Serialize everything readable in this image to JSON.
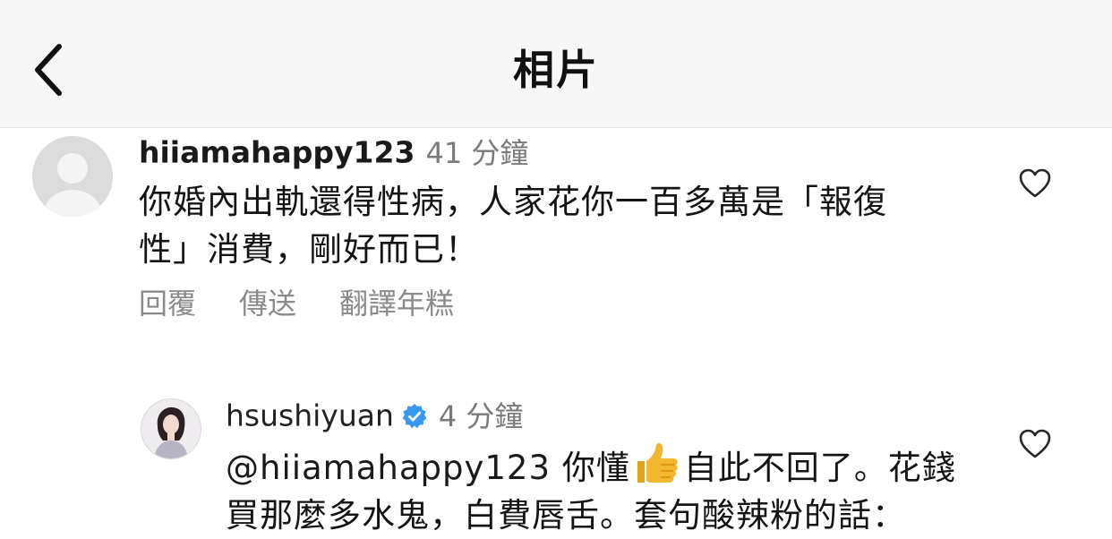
{
  "header": {
    "title": "相片"
  },
  "comments": [
    {
      "username": "hiiamahappy123",
      "time": "41 分鐘",
      "text_line1": "你婚內出軌還得性病，人家花你一百多萬是「報復",
      "text_line2": "性」消費，剛好而已！",
      "actions": [
        "回覆",
        "傳送",
        "翻譯年糕"
      ],
      "verified": false
    },
    {
      "username": "hsushiyuan",
      "time": "4 分鐘",
      "mention": "@hiiamahappy123",
      "text_line1_part1": " 你懂",
      "text_line1_part2": "自此不回了。花錢",
      "text_line2": "買那麼多水鬼，白費唇舌。套句酸辣粉的話：",
      "verified": true
    }
  ],
  "icons": {
    "back": "chevron-left-icon",
    "like": "heart-outline-icon",
    "verified": "verified-badge-icon",
    "thumbs_up": "thumbs-up-emoji",
    "avatar_default": "default-user-avatar"
  },
  "colors": {
    "header_bg": "#f7f7f7",
    "verified_blue": "#3897f0",
    "secondary_text": "#7a7a7a",
    "thumb_yellow": "#f2b631"
  }
}
